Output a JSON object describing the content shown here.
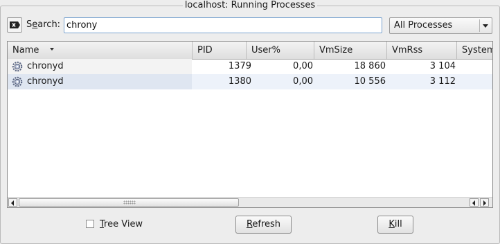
{
  "window": {
    "title": "localhost: Running Processes"
  },
  "search": {
    "label_pre": "S",
    "label_mnemonic": "e",
    "label_post": "arch:",
    "value": "chrony"
  },
  "filter": {
    "selected": "All Processes"
  },
  "table": {
    "columns": [
      "Name",
      "PID",
      "User%",
      "VmSize",
      "VmRss",
      "System"
    ],
    "sort_column": "Name",
    "rows": [
      {
        "name": "chronyd",
        "pid": "1379",
        "user": "0,00",
        "vmsize": "18 860",
        "vmrss": "3 104",
        "system": ""
      },
      {
        "name": "chronyd",
        "pid": "1380",
        "user": "0,00",
        "vmsize": "10 556",
        "vmrss": "3 112",
        "system": ""
      }
    ]
  },
  "controls": {
    "tree_view_mnemonic": "T",
    "tree_view_rest": "ree View",
    "refresh_mnemonic": "R",
    "refresh_rest": "efresh",
    "kill_mnemonic": "K",
    "kill_rest": "ill"
  },
  "colors": {
    "accent": "#7aa3cf",
    "selected_row": "#edf2fa"
  },
  "icons": {
    "clear": "clear-search-icon",
    "process": "process-gear-icon",
    "dropdown": "chevron-down-icon"
  }
}
